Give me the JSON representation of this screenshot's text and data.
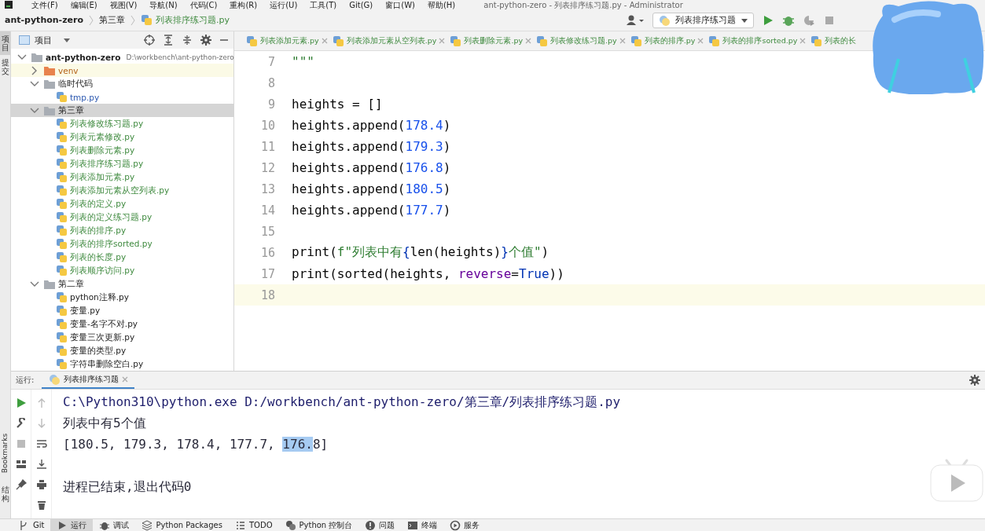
{
  "menu": [
    "文件(F)",
    "编辑(E)",
    "视图(V)",
    "导航(N)",
    "代码(C)",
    "重构(R)",
    "运行(U)",
    "工具(T)",
    "Git(G)",
    "窗口(W)",
    "帮助(H)"
  ],
  "window": {
    "title": "ant-python-zero - 列表排序练习题.py - Administrator"
  },
  "breadcrumb": [
    {
      "label": "ant-python-zero",
      "kind": "project"
    },
    {
      "label": "第三章",
      "kind": "folder"
    },
    {
      "label": "列表排序练习题.py",
      "kind": "file"
    }
  ],
  "run_config": {
    "label": "列表排序练习题"
  },
  "side_strip": [
    {
      "label": "项目",
      "kind": "cjk",
      "selected": true
    },
    {
      "label": "提交",
      "kind": "cjk",
      "selected": false
    },
    {
      "label": "Bookmarks",
      "kind": "latin",
      "selected": false
    },
    {
      "label": "结构",
      "kind": "cjk",
      "selected": false
    }
  ],
  "project": {
    "title": "项目",
    "tree": [
      {
        "label": "ant-python-zero",
        "path": "D:\\workbench\\ant-python-zero",
        "kind": "root",
        "expanded": true,
        "selected": false,
        "children": [
          {
            "label": "venv",
            "kind": "excluded",
            "expanded": false,
            "selected": false
          },
          {
            "label": "临时代码",
            "kind": "folder",
            "expanded": true,
            "selected": false,
            "children": [
              {
                "label": "tmp.py",
                "kind": "file",
                "added": false,
                "modified": true,
                "selected": false
              }
            ]
          },
          {
            "label": "第三章",
            "kind": "folder",
            "expanded": true,
            "selected": true,
            "children": [
              {
                "label": "列表修改练习题.py",
                "kind": "file",
                "added": true,
                "modified": false,
                "selected": false
              },
              {
                "label": "列表元素修改.py",
                "kind": "file",
                "added": true,
                "modified": false,
                "selected": false
              },
              {
                "label": "列表删除元素.py",
                "kind": "file",
                "added": true,
                "modified": false,
                "selected": false
              },
              {
                "label": "列表排序练习题.py",
                "kind": "file",
                "added": true,
                "modified": false,
                "selected": false
              },
              {
                "label": "列表添加元素.py",
                "kind": "file",
                "added": true,
                "modified": false,
                "selected": false
              },
              {
                "label": "列表添加元素从空列表.py",
                "kind": "file",
                "added": true,
                "modified": false,
                "selected": false
              },
              {
                "label": "列表的定义.py",
                "kind": "file",
                "added": true,
                "modified": false,
                "selected": false
              },
              {
                "label": "列表的定义练习题.py",
                "kind": "file",
                "added": true,
                "modified": false,
                "selected": false
              },
              {
                "label": "列表的排序.py",
                "kind": "file",
                "added": true,
                "modified": false,
                "selected": false
              },
              {
                "label": "列表的排序sorted.py",
                "kind": "file",
                "added": true,
                "modified": false,
                "selected": false
              },
              {
                "label": "列表的长度.py",
                "kind": "file",
                "added": true,
                "modified": false,
                "selected": false
              },
              {
                "label": "列表顺序访问.py",
                "kind": "file",
                "added": true,
                "modified": false,
                "selected": false
              }
            ]
          },
          {
            "label": "第二章",
            "kind": "folder",
            "expanded": true,
            "selected": false,
            "children": [
              {
                "label": "python注释.py",
                "kind": "file",
                "added": false,
                "modified": false,
                "selected": false
              },
              {
                "label": "变量.py",
                "kind": "file",
                "added": false,
                "modified": false,
                "selected": false
              },
              {
                "label": "变量-名字不对.py",
                "kind": "file",
                "added": false,
                "modified": false,
                "selected": false
              },
              {
                "label": "变量三次更新.py",
                "kind": "file",
                "added": false,
                "modified": false,
                "selected": false
              },
              {
                "label": "变量的类型.py",
                "kind": "file",
                "added": false,
                "modified": false,
                "selected": false
              },
              {
                "label": "字符串删除空白.py",
                "kind": "file",
                "added": false,
                "modified": false,
                "selected": false
              }
            ]
          }
        ]
      }
    ]
  },
  "editor_tabs": [
    {
      "label": "列表添加元素.py",
      "selected": false
    },
    {
      "label": "列表添加元素从空列表.py",
      "selected": false
    },
    {
      "label": "列表删除元素.py",
      "selected": false
    },
    {
      "label": "列表修改练习题.py",
      "selected": false
    },
    {
      "label": "列表的排序.py",
      "selected": false
    },
    {
      "label": "列表的排序sorted.py",
      "selected": false
    },
    {
      "label": "列表的长",
      "selected": false
    }
  ],
  "code": [
    {
      "number": "7",
      "current": false,
      "tokens": [
        {
          "text": "\"\"\"",
          "kind": "string"
        }
      ]
    },
    {
      "number": "8",
      "current": false
    },
    {
      "number": "9",
      "current": false,
      "tokens": [
        {
          "text": "heights = []",
          "kind": "plain"
        }
      ]
    },
    {
      "number": "10",
      "current": false,
      "tokens": [
        {
          "text": "heights.append(",
          "kind": "plain"
        },
        {
          "text": "178.4",
          "kind": "number"
        },
        {
          "text": ")",
          "kind": "plain"
        }
      ]
    },
    {
      "number": "11",
      "current": false,
      "tokens": [
        {
          "text": "heights.append(",
          "kind": "plain"
        },
        {
          "text": "179.3",
          "kind": "number"
        },
        {
          "text": ")",
          "kind": "plain"
        }
      ]
    },
    {
      "number": "12",
      "current": false,
      "tokens": [
        {
          "text": "heights.append(",
          "kind": "plain"
        },
        {
          "text": "176.8",
          "kind": "number"
        },
        {
          "text": ")",
          "kind": "plain"
        }
      ]
    },
    {
      "number": "13",
      "current": false,
      "tokens": [
        {
          "text": "heights.append(",
          "kind": "plain"
        },
        {
          "text": "180.5",
          "kind": "number"
        },
        {
          "text": ")",
          "kind": "plain"
        }
      ]
    },
    {
      "number": "14",
      "current": false,
      "tokens": [
        {
          "text": "heights.append(",
          "kind": "plain"
        },
        {
          "text": "177.7",
          "kind": "number"
        },
        {
          "text": ")",
          "kind": "plain"
        }
      ]
    },
    {
      "number": "15",
      "current": false
    },
    {
      "number": "16",
      "current": false,
      "tokens": [
        {
          "text": "print(",
          "kind": "plain"
        },
        {
          "text": "f\"列表中有",
          "kind": "string"
        },
        {
          "text": "{",
          "kind": "brace"
        },
        {
          "text": "len(heights)",
          "kind": "plain"
        },
        {
          "text": "}",
          "kind": "brace"
        },
        {
          "text": "个值\"",
          "kind": "string"
        },
        {
          "text": ")",
          "kind": "plain"
        }
      ]
    },
    {
      "number": "17",
      "current": false,
      "tokens": [
        {
          "text": "print(sorted(heights, ",
          "kind": "plain"
        },
        {
          "text": "reverse",
          "kind": "param"
        },
        {
          "text": "=",
          "kind": "plain"
        },
        {
          "text": "True",
          "kind": "keyword"
        },
        {
          "text": "))",
          "kind": "plain"
        }
      ]
    },
    {
      "number": "18",
      "current": true
    }
  ],
  "run": {
    "label": "运行:",
    "tab": "列表排序练习题",
    "output": [
      {
        "kind": "command",
        "segments": [
          {
            "text": "C:\\Python310\\python.exe D:/workbench/ant-python-zero/第三章/列表排序练习题.py",
            "selected": false
          }
        ]
      },
      {
        "kind": "text",
        "segments": [
          {
            "text": "列表中有5个值",
            "selected": false
          }
        ]
      },
      {
        "kind": "text",
        "segments": [
          {
            "text": "[180.5, 179.3, 178.4, 177.7, ",
            "selected": false
          },
          {
            "text": "176.",
            "selected": true
          },
          {
            "text": "8]",
            "selected": false
          }
        ]
      },
      {
        "kind": "blank"
      },
      {
        "kind": "text",
        "segments": [
          {
            "text": "进程已结束,退出代码0",
            "selected": false
          }
        ]
      }
    ]
  },
  "tool_windows": [
    {
      "label": "Git",
      "selected": false
    },
    {
      "label": "运行",
      "selected": true
    },
    {
      "label": "调试",
      "selected": false
    },
    {
      "label": "Python Packages",
      "selected": false
    },
    {
      "label": "TODO",
      "selected": false
    },
    {
      "label": "Python 控制台",
      "selected": false
    },
    {
      "label": "问题",
      "selected": false
    },
    {
      "label": "终端",
      "selected": false
    },
    {
      "label": "服务",
      "selected": false
    }
  ]
}
